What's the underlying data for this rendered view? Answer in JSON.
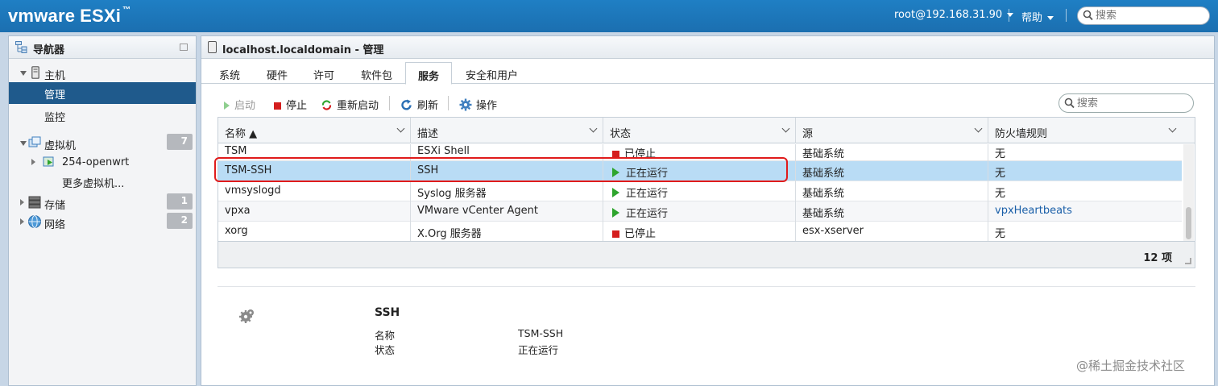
{
  "header": {
    "logo_brand": "vmware",
    "logo_product": "ESXi",
    "logo_tm": "™",
    "user": "root@192.168.31.90",
    "help": "帮助",
    "search_placeholder": "搜索"
  },
  "navigator": {
    "title": "导航器",
    "items": [
      {
        "label": "主机"
      },
      {
        "label": "管理"
      },
      {
        "label": "监控"
      },
      {
        "label": "虚拟机",
        "count": "7"
      },
      {
        "label": "254-openwrt"
      },
      {
        "label": "更多虚拟机..."
      },
      {
        "label": "存储",
        "count": "1"
      },
      {
        "label": "网络",
        "count": "2"
      }
    ]
  },
  "panel": {
    "title": "localhost.localdomain - 管理",
    "tabs": [
      "系统",
      "硬件",
      "许可",
      "软件包",
      "服务",
      "安全和用户"
    ],
    "active_tab": "服务",
    "toolbar": {
      "start": "启动",
      "stop": "停止",
      "restart": "重新启动",
      "refresh": "刷新",
      "actions": "操作",
      "search_placeholder": "搜索"
    },
    "grid": {
      "columns": [
        "名称 ▲",
        "描述",
        "状态",
        "源",
        "防火墙规则"
      ],
      "rows": [
        {
          "name": "TSM",
          "desc": "ESXi Shell",
          "status": "已停止",
          "source": "基础系统",
          "firewall": "无"
        },
        {
          "name": "TSM-SSH",
          "desc": "SSH",
          "status": "正在运行",
          "source": "基础系统",
          "firewall": "无"
        },
        {
          "name": "vmsyslogd",
          "desc": "Syslog 服务器",
          "status": "正在运行",
          "source": "基础系统",
          "firewall": "无"
        },
        {
          "name": "vpxa",
          "desc": "VMware vCenter Agent",
          "status": "正在运行",
          "source": "基础系统",
          "firewall": "vpxHeartbeats"
        },
        {
          "name": "xorg",
          "desc": "X.Org 服务器",
          "status": "已停止",
          "source": "esx-xserver",
          "firewall": "无"
        }
      ],
      "selected_row": "TSM-SSH",
      "total": "12 项"
    },
    "details": {
      "title": "SSH",
      "name_label": "名称",
      "name_value": "TSM-SSH",
      "status_label": "状态",
      "status_value": "正在运行"
    }
  },
  "watermark": "@稀土掘金技术社区",
  "colors": {
    "header_blue": "#1f7fc4",
    "nav_selected": "#1f5a8c",
    "row_selected": "#b9dcf5",
    "stopped_red": "#d41e1e",
    "running_green": "#2ea52e",
    "highlight_red": "#e01b1b"
  }
}
